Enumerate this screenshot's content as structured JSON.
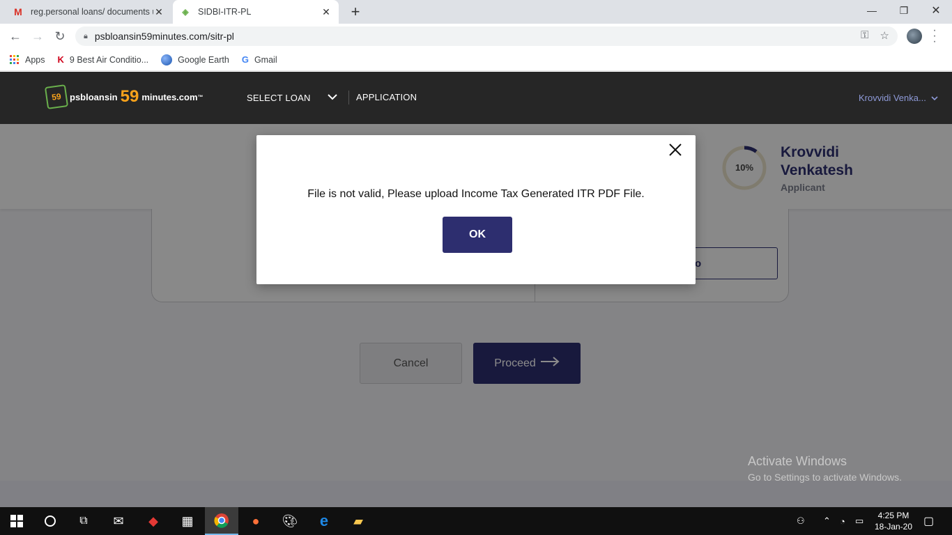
{
  "browser": {
    "tabs": [
      {
        "title": "reg.personal loans/ documents u",
        "icon": "gmail-icon",
        "active": false
      },
      {
        "title": "SIDBI-ITR-PL",
        "icon": "site-favicon",
        "active": true
      }
    ],
    "new_tab_symbol": "+",
    "address": "psbloansin59minutes.com/sitr-pl",
    "bookmarks": [
      {
        "label": "Apps",
        "icon": "apps-grid-icon"
      },
      {
        "label": "9 Best Air Conditio...",
        "icon": "k-icon"
      },
      {
        "label": "Google Earth",
        "icon": "google-earth-icon"
      },
      {
        "label": "Gmail",
        "icon": "google-icon"
      }
    ]
  },
  "site": {
    "logo": {
      "prefix": "psbloansin",
      "number": "59",
      "suffix": "minutes.com",
      "tm": "™",
      "badge": "59"
    },
    "nav": {
      "select_loan": "SELECT LOAN",
      "application": "APPLICATION"
    },
    "user_menu": "Krovvidi Venka...",
    "progress": {
      "percent": 10,
      "label": "10%"
    },
    "applicant": {
      "name_line1": "Krovvidi",
      "name_line2": "Venkatesh",
      "role": "Applicant"
    },
    "card_button_fragment": "o",
    "buttons": {
      "cancel": "Cancel",
      "proceed": "Proceed"
    }
  },
  "modal": {
    "message": "File is not valid, Please upload Income Tax Generated ITR PDF File.",
    "ok": "OK"
  },
  "windows_watermark": {
    "line1": "Activate Windows",
    "line2": "Go to Settings to activate Windows."
  },
  "taskbar": {
    "time": "4:25 PM",
    "date": "18-Jan-20"
  },
  "colors": {
    "brand_navy": "#2d2e6f",
    "brand_orange": "#f7a21b",
    "header_dark": "#262626"
  }
}
